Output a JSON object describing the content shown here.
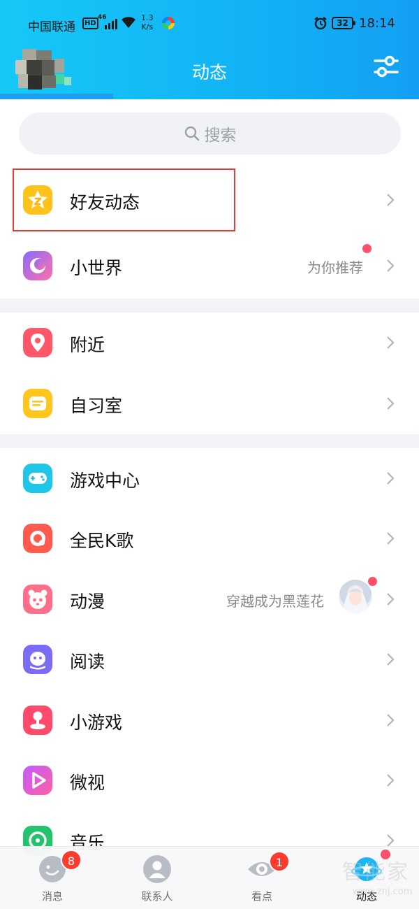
{
  "status_bar": {
    "carrier": "中国联通",
    "hd": "HD",
    "network": "46",
    "speed_value": "1.3",
    "speed_unit": "K/s",
    "battery": "32",
    "time": "18:14"
  },
  "header": {
    "title": "动态"
  },
  "search": {
    "placeholder": "搜索"
  },
  "sections": [
    [
      {
        "label": "好友动态",
        "icon": "qzone-star-icon"
      },
      {
        "label": "小世界",
        "icon": "small-world-icon",
        "right_text": "为你推荐"
      }
    ],
    [
      {
        "label": "附近",
        "icon": "location-pin-icon"
      },
      {
        "label": "自习室",
        "icon": "study-room-icon"
      }
    ],
    [
      {
        "label": "游戏中心",
        "icon": "gamepad-icon"
      },
      {
        "label": "全民K歌",
        "icon": "karaoke-icon"
      },
      {
        "label": "动漫",
        "icon": "anime-panda-icon",
        "right_text": "穿越成为黑莲花"
      },
      {
        "label": "阅读",
        "icon": "reading-icon"
      },
      {
        "label": "小游戏",
        "icon": "mini-game-icon"
      },
      {
        "label": "微视",
        "icon": "weishi-play-icon"
      },
      {
        "label": "音乐",
        "icon": "music-icon"
      }
    ]
  ],
  "bottom_nav": [
    {
      "label": "消息",
      "badge": "8",
      "icon": "message-smile-icon"
    },
    {
      "label": "联系人",
      "icon": "contacts-person-icon"
    },
    {
      "label": "看点",
      "badge": "1",
      "icon": "eye-icon"
    },
    {
      "label": "动态",
      "icon": "planet-star-icon",
      "active": true
    }
  ],
  "watermark": {
    "text": "智能家",
    "url": "www.znj.com"
  },
  "colors": {
    "header_start": "#16c8f7",
    "header_end": "#139ff4",
    "highlight_border": "#e33b32",
    "badge": "#ff3b30",
    "dot": "#ff4f6a"
  }
}
